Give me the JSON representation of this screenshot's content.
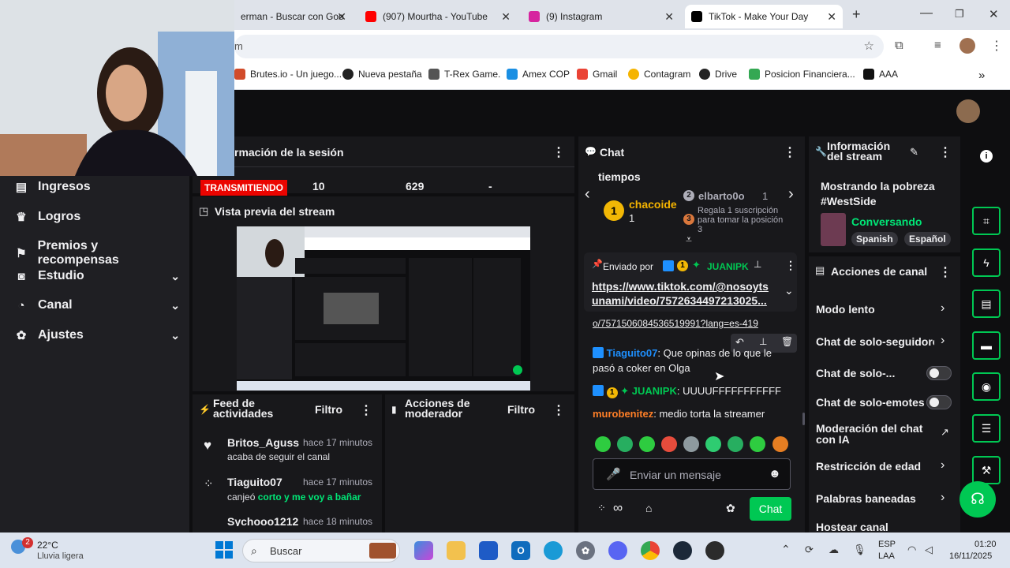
{
  "browser": {
    "tabs": [
      {
        "label": "erman - Buscar con Goo",
        "color": "#4285f4"
      },
      {
        "label": "(907) Mourtha - YouTube",
        "color": "#ff0000"
      },
      {
        "label": "(9) Instagram",
        "color": "#d6249f"
      },
      {
        "label": "TikTok - Make Your Day",
        "color": "#000000"
      }
    ],
    "new_tab": "+",
    "address": "m",
    "bookmarks": [
      "Brutes.io - Un juego...",
      "Nueva pestaña",
      "T-Rex Game.",
      "Amex COP",
      "Gmail",
      "Contagram",
      "Drive",
      "Posicion Financiera...",
      "AAA"
    ],
    "more": "»"
  },
  "nav": {
    "items": [
      {
        "label": "Ingresos",
        "icon": "income-icon"
      },
      {
        "label": "Logros",
        "icon": "trophy-icon"
      },
      {
        "label": "Premios y recompensas",
        "icon": "rewards-icon"
      },
      {
        "label": "Estudio",
        "icon": "studio-icon"
      },
      {
        "label": "Canal",
        "icon": "channel-icon"
      },
      {
        "label": "Ajustes",
        "icon": "gear-icon"
      }
    ]
  },
  "session": {
    "title": "rmación de la sesión",
    "live_badge": "TRANSMITIENDO",
    "stats": [
      "10",
      "629",
      "-"
    ]
  },
  "preview": {
    "title": "Vista previa del stream"
  },
  "feed": {
    "title_line1": "Feed de",
    "title_line2": "actividades",
    "filter": "Filtro",
    "items": [
      {
        "name": "Britos_Aguss",
        "time": "hace 17 minutos",
        "text": "acaba de seguir el canal",
        "highlight": ""
      },
      {
        "name": "Tiaguito07",
        "time": "hace 17 minutos",
        "text": "canjeó ",
        "highlight": "corto y me voy a bañar"
      },
      {
        "name": "Sychooo1212",
        "time": "hace 18 minutos",
        "text": "",
        "highlight": ""
      }
    ]
  },
  "mod": {
    "title_line1": "Acciones de",
    "title_line2": "moderador",
    "filter": "Filtro"
  },
  "chat": {
    "title": "Chat",
    "leaderboard": {
      "top_text": "tiempos",
      "first": {
        "name": "chacoide",
        "rank": "1",
        "count": "1"
      },
      "second": {
        "name": "elbarto0o",
        "rank": "2",
        "count": "1"
      },
      "third": {
        "rank": "3",
        "text": "Regala 1 suscripción para tomar la posición 3"
      }
    },
    "pinned": {
      "by_label": "Enviado por",
      "badge": "1",
      "user": "JUANIPK",
      "link_line1": "https://www.tiktok.com/@nosoyts",
      "link_line2": "unami/video/7572634497213025..."
    },
    "messages": [
      {
        "user": "",
        "text": "o/7571506084536519991?lang=es-419"
      },
      {
        "user": "Tiaguito07",
        "text": ": Que opinas de lo que le pasó a coker en Olga",
        "color": "#1e90ff"
      },
      {
        "user": "JUANIPK",
        "text": ": UUUUFFFFFFFFFFF",
        "color": "#00c853"
      },
      {
        "user": "murobenitez",
        "text": ": medio torta la streamer",
        "color": "#ff7f27"
      }
    ],
    "input_placeholder": "Enviar un mensaje",
    "send_label": "Chat",
    "infinity": "∞"
  },
  "stream_info": {
    "title_line1": "Información",
    "title_line2": "del stream",
    "stream_title": "Mostrando la pobreza #WestSide",
    "category": "Conversando",
    "tags": [
      "Spanish",
      "Español"
    ]
  },
  "channel_actions": {
    "title": "Acciones de canal",
    "items": [
      {
        "label": "Modo lento",
        "control": "chevron"
      },
      {
        "label": "Chat de solo-seguidores",
        "control": "chevron"
      },
      {
        "label": "Chat de solo-...",
        "control": "toggle"
      },
      {
        "label": "Chat de solo-emotes",
        "control": "toggle"
      },
      {
        "label": "Moderación del chat con IA",
        "control": "external"
      },
      {
        "label": "Restricción de edad",
        "control": "chevron"
      },
      {
        "label": "Palabras baneadas",
        "control": "chevron"
      },
      {
        "label": "Hostear canal",
        "control": "none"
      }
    ]
  },
  "taskbar": {
    "weather_temp": "22°C",
    "weather_desc": "Lluvia ligera",
    "weather_badge": "2",
    "search": "Buscar",
    "lang1": "ESP",
    "lang2": "LAA",
    "time": "01:20",
    "date": "16/11/2025"
  },
  "colors": {
    "accent": "#00c853",
    "live": "#eb0400",
    "panel": "#18181b",
    "bg": "#0e0e10"
  }
}
